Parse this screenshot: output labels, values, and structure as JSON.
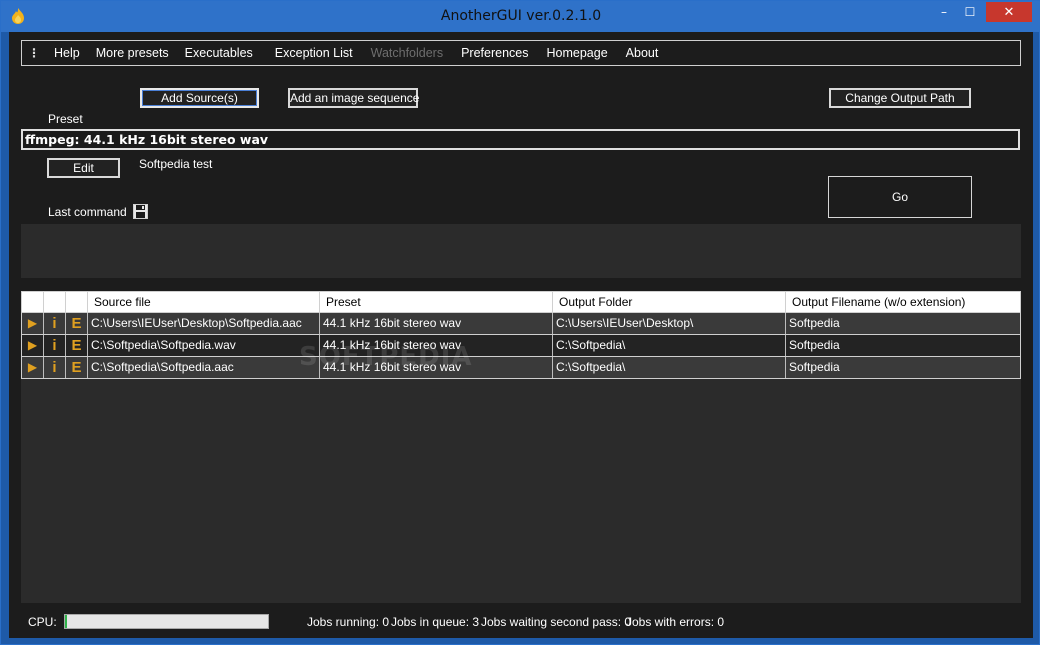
{
  "window": {
    "title": "AnotherGUI ver.0.2.1.0",
    "minimize": "–",
    "maximize": "☐",
    "close": "✕"
  },
  "menu": {
    "grip": "⋮",
    "items": [
      {
        "label": "Help",
        "disabled": false
      },
      {
        "label": "More presets",
        "disabled": false
      },
      {
        "label": "Executables",
        "disabled": false
      },
      {
        "label": "Exception List",
        "disabled": false
      },
      {
        "label": "Watchfolders",
        "disabled": true
      },
      {
        "label": "Preferences",
        "disabled": false
      },
      {
        "label": "Homepage",
        "disabled": false
      },
      {
        "label": "About",
        "disabled": false
      }
    ]
  },
  "toolbar": {
    "add_source": "Add Source(s)",
    "add_image_sequence": "Add an image sequence",
    "change_output_path": "Change Output Path"
  },
  "preset": {
    "label": "Preset",
    "value": "ffmpeg: 44.1 kHz 16bit stereo wav",
    "edit": "Edit",
    "description": "Softpedia test"
  },
  "go": "Go",
  "last_command": {
    "label": "Last command",
    "icon": "save-icon"
  },
  "grid": {
    "columns": [
      "Source file",
      "Preset",
      "Output Folder",
      "Output Filename (w/o extension)"
    ],
    "action_icons": {
      "play": "▶",
      "info": "i",
      "edit": "E"
    },
    "rows": [
      {
        "source": "C:\\Users\\IEUser\\Desktop\\Softpedia.aac",
        "preset": "44.1 kHz 16bit stereo wav",
        "output_folder": "C:\\Users\\IEUser\\Desktop\\",
        "filename": "Softpedia"
      },
      {
        "source": "C:\\Softpedia\\Softpedia.wav",
        "preset": "44.1 kHz 16bit stereo wav",
        "output_folder": "C:\\Softpedia\\",
        "filename": "Softpedia"
      },
      {
        "source": "C:\\Softpedia\\Softpedia.aac",
        "preset": "44.1 kHz 16bit stereo wav",
        "output_folder": "C:\\Softpedia\\",
        "filename": "Softpedia"
      }
    ]
  },
  "watermark": "SOFTPEDIA",
  "status": {
    "cpu_label": "CPU:",
    "cpu_fraction": 0.01,
    "jobs_running": "Jobs running: 0",
    "jobs_queue": "Jobs in queue: 3",
    "jobs_second_pass": "Jobs waiting second pass: 0",
    "jobs_errors": "Jobs with errors: 0"
  },
  "colors": {
    "title_bar": "#2f72c9",
    "client_bg": "#1c1c1c",
    "action_icon": "#e0a020",
    "cpu_fill": "#2fb34a",
    "close_button": "#c7372d"
  }
}
